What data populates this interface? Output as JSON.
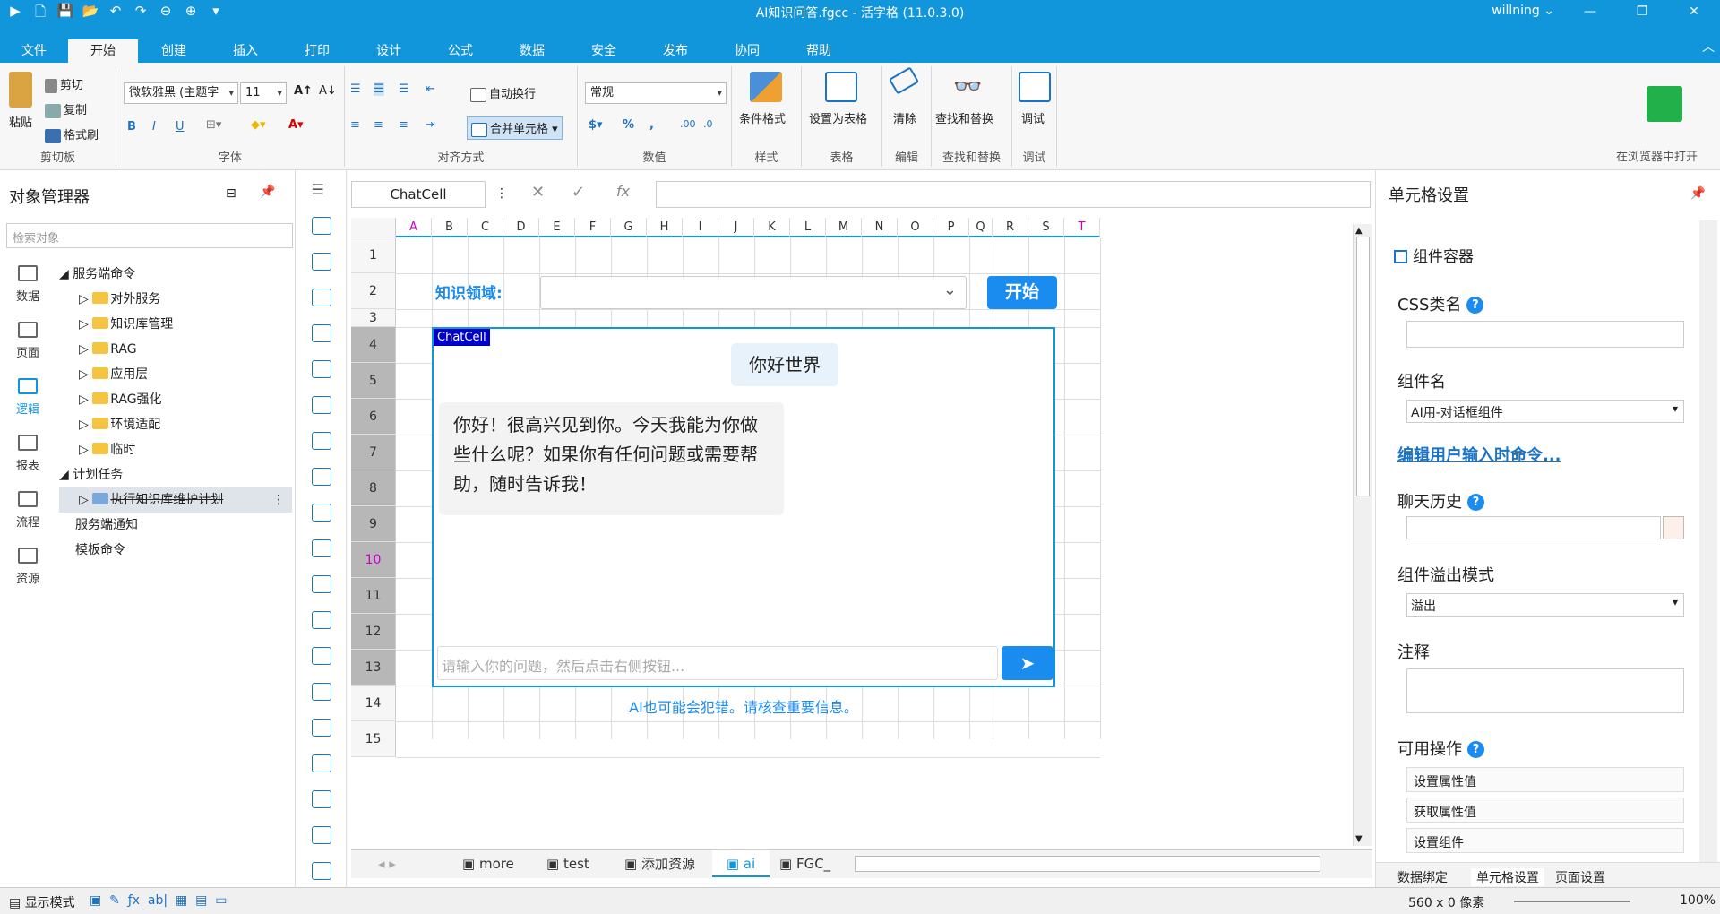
{
  "window": {
    "title": "AI知识问答.fgcc - 活字格 (11.0.3.0)",
    "user": "willning",
    "controls": [
      "—",
      "❐",
      "✕"
    ]
  },
  "menu": {
    "tabs": [
      "文件",
      "开始",
      "创建",
      "插入",
      "打印",
      "设计",
      "公式",
      "数据",
      "安全",
      "发布",
      "协同",
      "帮助"
    ],
    "active": "开始"
  },
  "ribbon": {
    "clipboard": {
      "paste": "粘贴",
      "cut": "剪切",
      "copy": "复制",
      "format_painter": "格式刷",
      "label": "剪切板"
    },
    "font": {
      "family": "微软雅黑 (主题字",
      "size": "11",
      "label": "字体"
    },
    "align": {
      "wrap": "自动换行",
      "merge": "合并单元格",
      "label": "对齐方式"
    },
    "number": {
      "format": "常规",
      "label": "数值"
    },
    "style": {
      "cond": "条件格式",
      "label": "样式"
    },
    "table": {
      "set": "设置为表格",
      "label": "表格"
    },
    "edit": {
      "clear": "清除",
      "label": "编辑"
    },
    "find": {
      "find": "查找和替换",
      "label": "查找和替换"
    },
    "debug": {
      "debug": "调试",
      "label": "调试"
    },
    "run": {
      "label": "在浏览器中打开"
    }
  },
  "left": {
    "title": "对象管理器",
    "search_placeholder": "检索对象",
    "nav": [
      "数据",
      "页面",
      "逻辑",
      "报表",
      "流程",
      "资源"
    ],
    "nav_active": "逻辑",
    "tree": {
      "server_cmd": "服务端命令",
      "folders": [
        "对外服务",
        "知识库管理",
        "RAG",
        "应用层",
        "RAG强化",
        "环境适配",
        "临时"
      ],
      "plan": "计划任务",
      "plan_item": "执行知识库维护计划",
      "notify": "服务端通知",
      "template": "模板命令"
    }
  },
  "formula": {
    "name": "ChatCell",
    "value": ""
  },
  "sheet": {
    "columns": [
      "A",
      "B",
      "C",
      "D",
      "E",
      "F",
      "G",
      "H",
      "I",
      "J",
      "K",
      "L",
      "M",
      "N",
      "O",
      "P",
      "Q",
      "R",
      "S",
      "T"
    ],
    "rows": [
      "1",
      "2",
      "3",
      "4",
      "5",
      "6",
      "7",
      "8",
      "9",
      "10",
      "11",
      "12",
      "13",
      "14",
      "15"
    ],
    "knowledge_label": "知识领域:",
    "start_button": "开始",
    "chat": {
      "tag": "ChatCell",
      "user_msg": "你好世界",
      "ai_msg": "你好！很高兴见到你。今天我能为你做些什么呢？如果你有任何问题或需要帮助，随时告诉我！",
      "input_placeholder": "请输入你的问题，然后点击右侧按钮...",
      "send_icon": "paper-plane"
    },
    "disclaimer": "AI也可能会犯错。请核查重要信息。",
    "tabs": [
      "more",
      "test",
      "添加资源",
      "ai",
      "FGC_"
    ],
    "active_tab": "ai"
  },
  "right": {
    "title": "单元格设置",
    "section": "组件容器",
    "css_label": "CSS类名",
    "css_value": "",
    "component_label": "组件名",
    "component_value": "AI用-对话框组件",
    "edit_link": "编辑用户输入时命令...",
    "history_label": "聊天历史",
    "overflow_label": "组件溢出模式",
    "overflow_value": "溢出",
    "note_label": "注释",
    "ops_label": "可用操作",
    "ops": [
      "设置属性值",
      "获取属性值",
      "设置组件"
    ],
    "tabs": [
      "数据绑定",
      "单元格设置",
      "页面设置"
    ]
  },
  "status": {
    "mode": "显示模式",
    "size": "560 x 0 像素",
    "zoom": "100%"
  }
}
